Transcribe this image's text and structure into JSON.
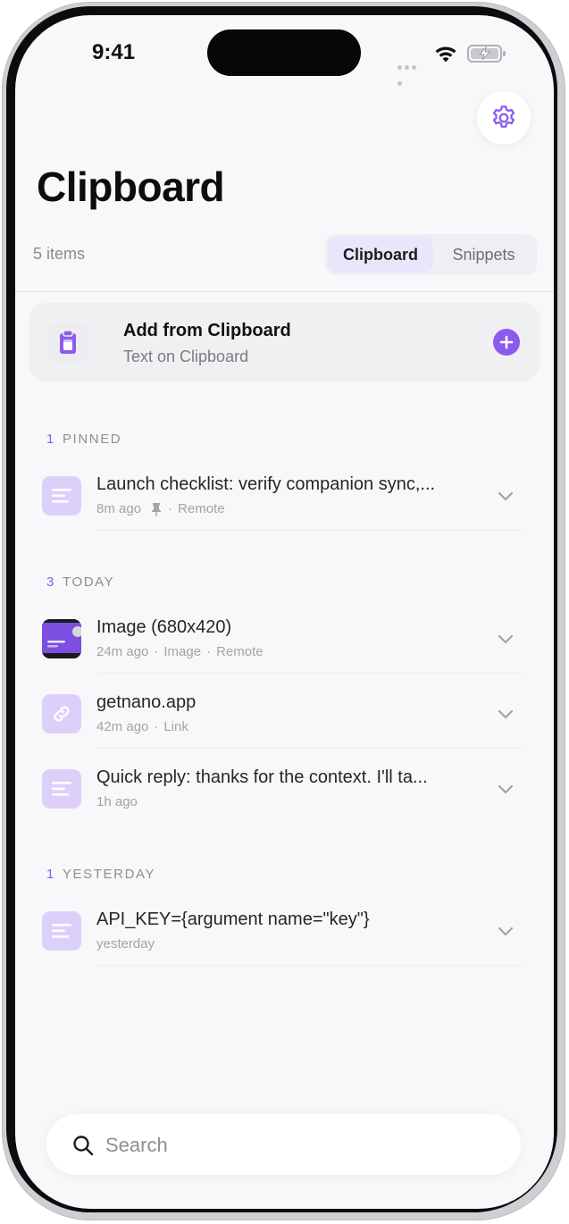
{
  "status_bar": {
    "time": "9:41"
  },
  "header": {
    "title": "Clipboard",
    "item_count": "5 items"
  },
  "segmented": {
    "options": [
      "Clipboard",
      "Snippets"
    ],
    "selected": "Clipboard"
  },
  "add_card": {
    "title": "Add from Clipboard",
    "subtitle": "Text on Clipboard"
  },
  "sections": [
    {
      "count": "1",
      "label": "PINNED",
      "items": [
        {
          "type": "text",
          "title": "Launch checklist: verify companion sync,...",
          "meta": [
            "8m ago",
            "Remote"
          ],
          "pinned": true
        }
      ]
    },
    {
      "count": "3",
      "label": "TODAY",
      "items": [
        {
          "type": "image",
          "title": "Image (680x420)",
          "meta": [
            "24m ago",
            "Image",
            "Remote"
          ]
        },
        {
          "type": "link",
          "title": "getnano.app",
          "meta": [
            "42m ago",
            "Link"
          ]
        },
        {
          "type": "text",
          "title": "Quick reply: thanks for the context. I'll ta...",
          "meta": [
            "1h ago"
          ]
        }
      ]
    },
    {
      "count": "1",
      "label": "YESTERDAY",
      "items": [
        {
          "type": "text",
          "title": "API_KEY={argument name=\"key\"}",
          "meta": [
            "yesterday"
          ]
        }
      ]
    }
  ],
  "search": {
    "placeholder": "Search",
    "value": ""
  },
  "colors": {
    "accent": "#8d5af0",
    "thumb_bg": "#dcd0fb",
    "background": "#f8f8fa"
  },
  "icons": [
    "settings-gear",
    "clipboard",
    "plus",
    "text-lines",
    "link",
    "image",
    "pin",
    "chevron-down",
    "search",
    "wifi",
    "battery-charging"
  ]
}
